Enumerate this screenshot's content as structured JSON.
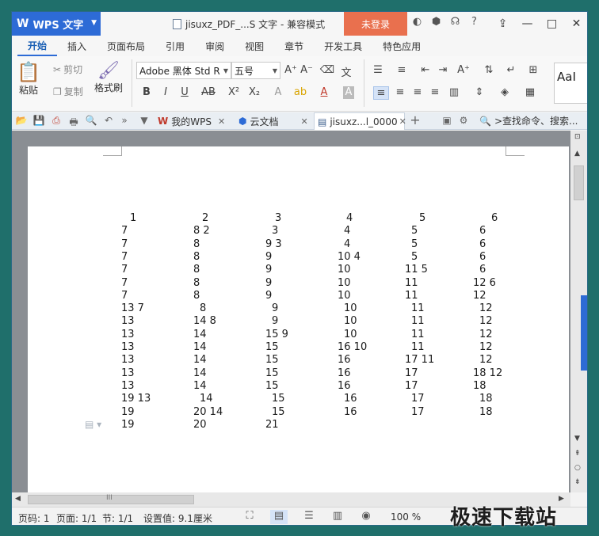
{
  "app": {
    "name": "WPS 文字",
    "logo_glyph": "W"
  },
  "title": {
    "text": "jisuxz_PDF_...S 文字 - 兼容模式"
  },
  "login_label": "未登录",
  "ribbon_tabs": [
    "开始",
    "插入",
    "页面布局",
    "引用",
    "审阅",
    "视图",
    "章节",
    "开发工具",
    "特色应用"
  ],
  "toolbar": {
    "paste": "粘贴",
    "cut": "剪切",
    "copy": "复制",
    "format_painter": "格式刷",
    "font_family": "Adobe 黑体 Std R",
    "font_size": "五号",
    "style_preview": "AaI"
  },
  "doc_tabs": [
    {
      "label": "我的WPS",
      "active": false
    },
    {
      "label": "云文档",
      "active": false
    },
    {
      "label": "jisuxz...l_0000",
      "active": true
    }
  ],
  "search": {
    "placeholder": ">查找命令、搜索..."
  },
  "document": {
    "rows": [
      [
        "1",
        "2",
        "3",
        "4",
        "5",
        "6"
      ],
      [
        "7",
        "8 2",
        "3",
        "4",
        "5",
        "6"
      ],
      [
        "7",
        "8",
        "9 3",
        "4",
        "5",
        "6"
      ],
      [
        "7",
        "8",
        "9",
        "10 4",
        "5",
        "6"
      ],
      [
        "7",
        "8",
        "9",
        "10",
        "11 5",
        "6"
      ],
      [
        "7",
        "8",
        "9",
        "10",
        "11",
        "12 6"
      ],
      [
        "7",
        "8",
        "9",
        "10",
        "11",
        "12"
      ],
      [
        "13 7",
        "8",
        "9",
        "10",
        "11",
        "12"
      ],
      [
        "13",
        "14 8",
        "9",
        "10",
        "11",
        "12"
      ],
      [
        "13",
        "14",
        "15 9",
        "10",
        "11",
        "12"
      ],
      [
        "13",
        "14",
        "15",
        "16 10",
        "11",
        "12"
      ],
      [
        "13",
        "14",
        "15",
        "16",
        "17 11",
        "12"
      ],
      [
        "13",
        "14",
        "15",
        "16",
        "17",
        "18 12"
      ],
      [
        "13",
        "14",
        "15",
        "16",
        "17",
        "18"
      ],
      [
        "19 13",
        "14",
        "15",
        "16",
        "17",
        "18"
      ],
      [
        "19",
        "20 14",
        "15",
        "16",
        "17",
        "18"
      ],
      [
        "19",
        "20",
        "21"
      ]
    ]
  },
  "status": {
    "page_code": "页码: 1",
    "pages": "页面: 1/1",
    "section": "节: 1/1",
    "setting": "设置值: 9.1厘米",
    "zoom": "100 %"
  },
  "hscroll_label": "III",
  "watermark": "极速下载站"
}
